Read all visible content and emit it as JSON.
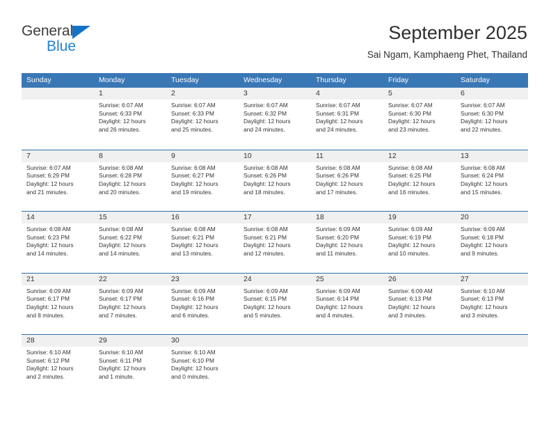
{
  "brand": {
    "logo_word_1": "General",
    "logo_word_2": "Blue",
    "logo_triangle_icon": "triangle-icon",
    "accent_blue": "#2083d4",
    "logo_dark": "#3c3c3c"
  },
  "header": {
    "title": "September 2025",
    "subtitle": "Sai Ngam, Kamphaeng Phet, Thailand"
  },
  "calendar": {
    "header_bg": "#3a77b5",
    "row_border": "#2e6da8",
    "day_band_bg": "#f0f0f0",
    "weekdays": [
      "Sunday",
      "Monday",
      "Tuesday",
      "Wednesday",
      "Thursday",
      "Friday",
      "Saturday"
    ],
    "weeks": [
      [
        {
          "day": "",
          "lines": []
        },
        {
          "day": "1",
          "lines": [
            "Sunrise: 6:07 AM",
            "Sunset: 6:33 PM",
            "Daylight: 12 hours",
            "and 26 minutes."
          ]
        },
        {
          "day": "2",
          "lines": [
            "Sunrise: 6:07 AM",
            "Sunset: 6:33 PM",
            "Daylight: 12 hours",
            "and 25 minutes."
          ]
        },
        {
          "day": "3",
          "lines": [
            "Sunrise: 6:07 AM",
            "Sunset: 6:32 PM",
            "Daylight: 12 hours",
            "and 24 minutes."
          ]
        },
        {
          "day": "4",
          "lines": [
            "Sunrise: 6:07 AM",
            "Sunset: 6:31 PM",
            "Daylight: 12 hours",
            "and 24 minutes."
          ]
        },
        {
          "day": "5",
          "lines": [
            "Sunrise: 6:07 AM",
            "Sunset: 6:30 PM",
            "Daylight: 12 hours",
            "and 23 minutes."
          ]
        },
        {
          "day": "6",
          "lines": [
            "Sunrise: 6:07 AM",
            "Sunset: 6:30 PM",
            "Daylight: 12 hours",
            "and 22 minutes."
          ]
        }
      ],
      [
        {
          "day": "7",
          "lines": [
            "Sunrise: 6:07 AM",
            "Sunset: 6:29 PM",
            "Daylight: 12 hours",
            "and 21 minutes."
          ]
        },
        {
          "day": "8",
          "lines": [
            "Sunrise: 6:08 AM",
            "Sunset: 6:28 PM",
            "Daylight: 12 hours",
            "and 20 minutes."
          ]
        },
        {
          "day": "9",
          "lines": [
            "Sunrise: 6:08 AM",
            "Sunset: 6:27 PM",
            "Daylight: 12 hours",
            "and 19 minutes."
          ]
        },
        {
          "day": "10",
          "lines": [
            "Sunrise: 6:08 AM",
            "Sunset: 6:26 PM",
            "Daylight: 12 hours",
            "and 18 minutes."
          ]
        },
        {
          "day": "11",
          "lines": [
            "Sunrise: 6:08 AM",
            "Sunset: 6:26 PM",
            "Daylight: 12 hours",
            "and 17 minutes."
          ]
        },
        {
          "day": "12",
          "lines": [
            "Sunrise: 6:08 AM",
            "Sunset: 6:25 PM",
            "Daylight: 12 hours",
            "and 16 minutes."
          ]
        },
        {
          "day": "13",
          "lines": [
            "Sunrise: 6:08 AM",
            "Sunset: 6:24 PM",
            "Daylight: 12 hours",
            "and 15 minutes."
          ]
        }
      ],
      [
        {
          "day": "14",
          "lines": [
            "Sunrise: 6:08 AM",
            "Sunset: 6:23 PM",
            "Daylight: 12 hours",
            "and 14 minutes."
          ]
        },
        {
          "day": "15",
          "lines": [
            "Sunrise: 6:08 AM",
            "Sunset: 6:22 PM",
            "Daylight: 12 hours",
            "and 14 minutes."
          ]
        },
        {
          "day": "16",
          "lines": [
            "Sunrise: 6:08 AM",
            "Sunset: 6:21 PM",
            "Daylight: 12 hours",
            "and 13 minutes."
          ]
        },
        {
          "day": "17",
          "lines": [
            "Sunrise: 6:08 AM",
            "Sunset: 6:21 PM",
            "Daylight: 12 hours",
            "and 12 minutes."
          ]
        },
        {
          "day": "18",
          "lines": [
            "Sunrise: 6:09 AM",
            "Sunset: 6:20 PM",
            "Daylight: 12 hours",
            "and 11 minutes."
          ]
        },
        {
          "day": "19",
          "lines": [
            "Sunrise: 6:09 AM",
            "Sunset: 6:19 PM",
            "Daylight: 12 hours",
            "and 10 minutes."
          ]
        },
        {
          "day": "20",
          "lines": [
            "Sunrise: 6:09 AM",
            "Sunset: 6:18 PM",
            "Daylight: 12 hours",
            "and 9 minutes."
          ]
        }
      ],
      [
        {
          "day": "21",
          "lines": [
            "Sunrise: 6:09 AM",
            "Sunset: 6:17 PM",
            "Daylight: 12 hours",
            "and 8 minutes."
          ]
        },
        {
          "day": "22",
          "lines": [
            "Sunrise: 6:09 AM",
            "Sunset: 6:17 PM",
            "Daylight: 12 hours",
            "and 7 minutes."
          ]
        },
        {
          "day": "23",
          "lines": [
            "Sunrise: 6:09 AM",
            "Sunset: 6:16 PM",
            "Daylight: 12 hours",
            "and 6 minutes."
          ]
        },
        {
          "day": "24",
          "lines": [
            "Sunrise: 6:09 AM",
            "Sunset: 6:15 PM",
            "Daylight: 12 hours",
            "and 5 minutes."
          ]
        },
        {
          "day": "25",
          "lines": [
            "Sunrise: 6:09 AM",
            "Sunset: 6:14 PM",
            "Daylight: 12 hours",
            "and 4 minutes."
          ]
        },
        {
          "day": "26",
          "lines": [
            "Sunrise: 6:09 AM",
            "Sunset: 6:13 PM",
            "Daylight: 12 hours",
            "and 3 minutes."
          ]
        },
        {
          "day": "27",
          "lines": [
            "Sunrise: 6:10 AM",
            "Sunset: 6:13 PM",
            "Daylight: 12 hours",
            "and 3 minutes."
          ]
        }
      ],
      [
        {
          "day": "28",
          "lines": [
            "Sunrise: 6:10 AM",
            "Sunset: 6:12 PM",
            "Daylight: 12 hours",
            "and 2 minutes."
          ]
        },
        {
          "day": "29",
          "lines": [
            "Sunrise: 6:10 AM",
            "Sunset: 6:11 PM",
            "Daylight: 12 hours",
            "and 1 minute."
          ]
        },
        {
          "day": "30",
          "lines": [
            "Sunrise: 6:10 AM",
            "Sunset: 6:10 PM",
            "Daylight: 12 hours",
            "and 0 minutes."
          ]
        },
        {
          "day": "",
          "lines": []
        },
        {
          "day": "",
          "lines": []
        },
        {
          "day": "",
          "lines": []
        },
        {
          "day": "",
          "lines": []
        }
      ]
    ]
  }
}
